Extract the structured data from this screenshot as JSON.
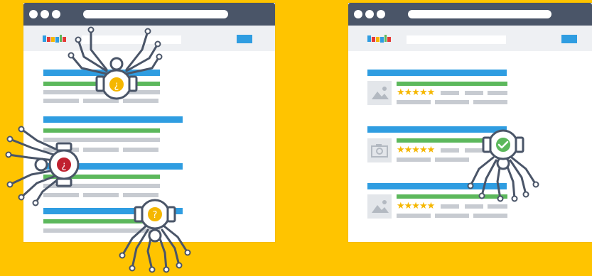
{
  "colors": {
    "background": "#ffc400",
    "titlebar": "#4a5568",
    "link_blue": "#2f9de1",
    "url_green": "#5cb85c",
    "text_gray": "#c7cbd1",
    "star": "#f5b700",
    "robot_stroke": "#4a5568",
    "badge_yellow": "#f5b700",
    "badge_red": "#c0212f",
    "badge_green": "#5cb85c"
  },
  "left_window": {
    "badges": [
      {
        "icon": "inverted-question-icon",
        "glyph": "¿"
      },
      {
        "icon": "inverted-question-icon",
        "glyph": "¿"
      },
      {
        "icon": "question-icon",
        "glyph": "?"
      }
    ]
  },
  "right_window": {
    "results": [
      {
        "thumbnail_icon": "image-icon",
        "stars": "★★★★★"
      },
      {
        "thumbnail_icon": "camera-icon",
        "stars": "★★★★★"
      },
      {
        "thumbnail_icon": "image-icon",
        "stars": "★★★★★"
      }
    ],
    "badge": {
      "icon": "check-icon"
    }
  }
}
